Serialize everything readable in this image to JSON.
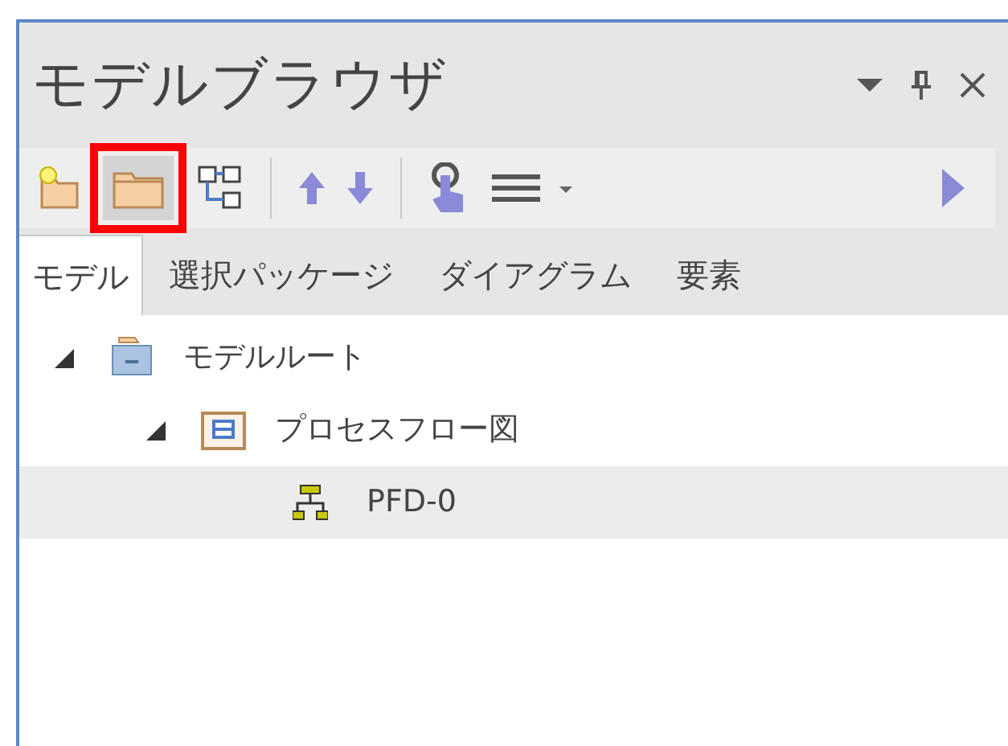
{
  "panel": {
    "title": "モデルブラウザ"
  },
  "title_controls": [
    {
      "kind": "dropdown"
    },
    {
      "kind": "pin"
    },
    {
      "kind": "close"
    }
  ],
  "toolbar": [
    {
      "kind": "new-package"
    },
    {
      "kind": "folder",
      "highlighted": true
    },
    {
      "kind": "tree"
    },
    {
      "kind": "separator"
    },
    {
      "kind": "up"
    },
    {
      "kind": "down"
    },
    {
      "kind": "separator"
    },
    {
      "kind": "hand"
    },
    {
      "kind": "menu"
    },
    {
      "kind": "play"
    }
  ],
  "tabs": [
    {
      "label": "モデル",
      "selected": true
    },
    {
      "label": "選択パッケージ",
      "selected": false
    },
    {
      "label": "ダイアグラム",
      "selected": false
    },
    {
      "label": "要素",
      "selected": false
    }
  ],
  "tree": [
    {
      "label": "モデルルート",
      "kind": "root",
      "expanded": true,
      "selected": false,
      "children": [
        {
          "label": "プロセスフロー図",
          "kind": "package",
          "expanded": true,
          "selected": false,
          "children": [
            {
              "label": "PFD-0",
              "kind": "diagram",
              "selected": true
            }
          ]
        }
      ]
    }
  ]
}
